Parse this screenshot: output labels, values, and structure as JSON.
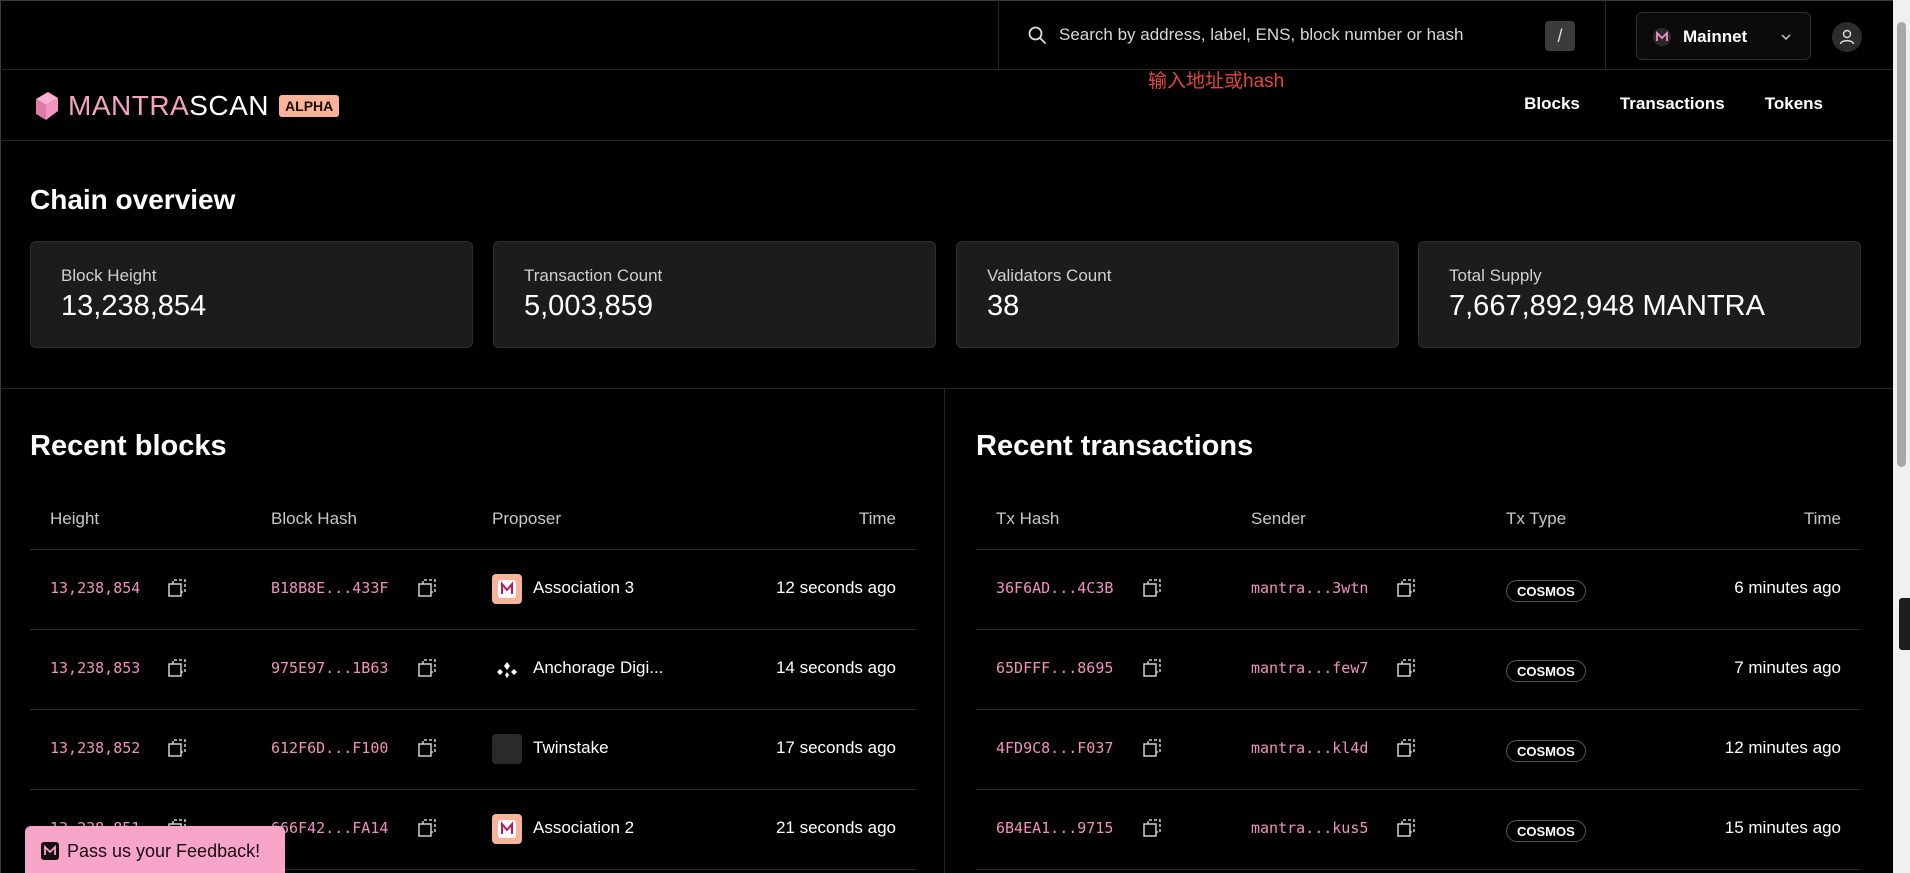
{
  "search": {
    "placeholder": "Search by address, label, ENS, block number or hash",
    "shortcut": "/"
  },
  "network": {
    "label": "Mainnet"
  },
  "brand": {
    "name_a": "M",
    "name_b": "ANTRA",
    "name_c": "SCAN",
    "badge": "ALPHA"
  },
  "annotation": "输入地址或hash",
  "nav": {
    "blocks": "Blocks",
    "transactions": "Transactions",
    "tokens": "Tokens"
  },
  "overview": {
    "title": "Chain overview",
    "stats": [
      {
        "label": "Block Height",
        "value": "13,238,854"
      },
      {
        "label": "Transaction Count",
        "value": "5,003,859"
      },
      {
        "label": "Validators Count",
        "value": "38"
      },
      {
        "label": "Total Supply",
        "value": "7,667,892,948 MANTRA"
      }
    ]
  },
  "blocks": {
    "title": "Recent blocks",
    "headers": {
      "height": "Height",
      "hash": "Block Hash",
      "proposer": "Proposer",
      "time": "Time"
    },
    "rows": [
      {
        "height": "13,238,854",
        "hash": "B18B8E...433F",
        "proposer": "Association 3",
        "time": "12 seconds ago",
        "avatar": "mantra"
      },
      {
        "height": "13,238,853",
        "hash": "975E97...1B63",
        "proposer": "Anchorage Digi...",
        "time": "14 seconds ago",
        "avatar": "anchorage"
      },
      {
        "height": "13,238,852",
        "hash": "612F6D...F100",
        "proposer": "Twinstake",
        "time": "17 seconds ago",
        "avatar": "blank"
      },
      {
        "height": "13,238,851",
        "hash": "666F42...FA14",
        "proposer": "Association 2",
        "time": "21 seconds ago",
        "avatar": "mantra"
      }
    ]
  },
  "transactions": {
    "title": "Recent transactions",
    "headers": {
      "hash": "Tx Hash",
      "sender": "Sender",
      "type": "Tx Type",
      "time": "Time"
    },
    "rows": [
      {
        "hash": "36F6AD...4C3B",
        "sender": "mantra...3wtn",
        "type": "COSMOS",
        "time": "6 minutes ago"
      },
      {
        "hash": "65DFFF...8695",
        "sender": "mantra...few7",
        "type": "COSMOS",
        "time": "7 minutes ago"
      },
      {
        "hash": "4FD9C8...F037",
        "sender": "mantra...kl4d",
        "type": "COSMOS",
        "time": "12 minutes ago"
      },
      {
        "hash": "6B4EA1...9715",
        "sender": "mantra...kus5",
        "type": "COSMOS",
        "time": "15 minutes ago"
      }
    ]
  },
  "feedback": {
    "label": "Pass us your Feedback!"
  },
  "colors": {
    "accent": "#f48fc2",
    "badge": "#f8b49a",
    "feedback_bg": "#f6a5c9"
  }
}
